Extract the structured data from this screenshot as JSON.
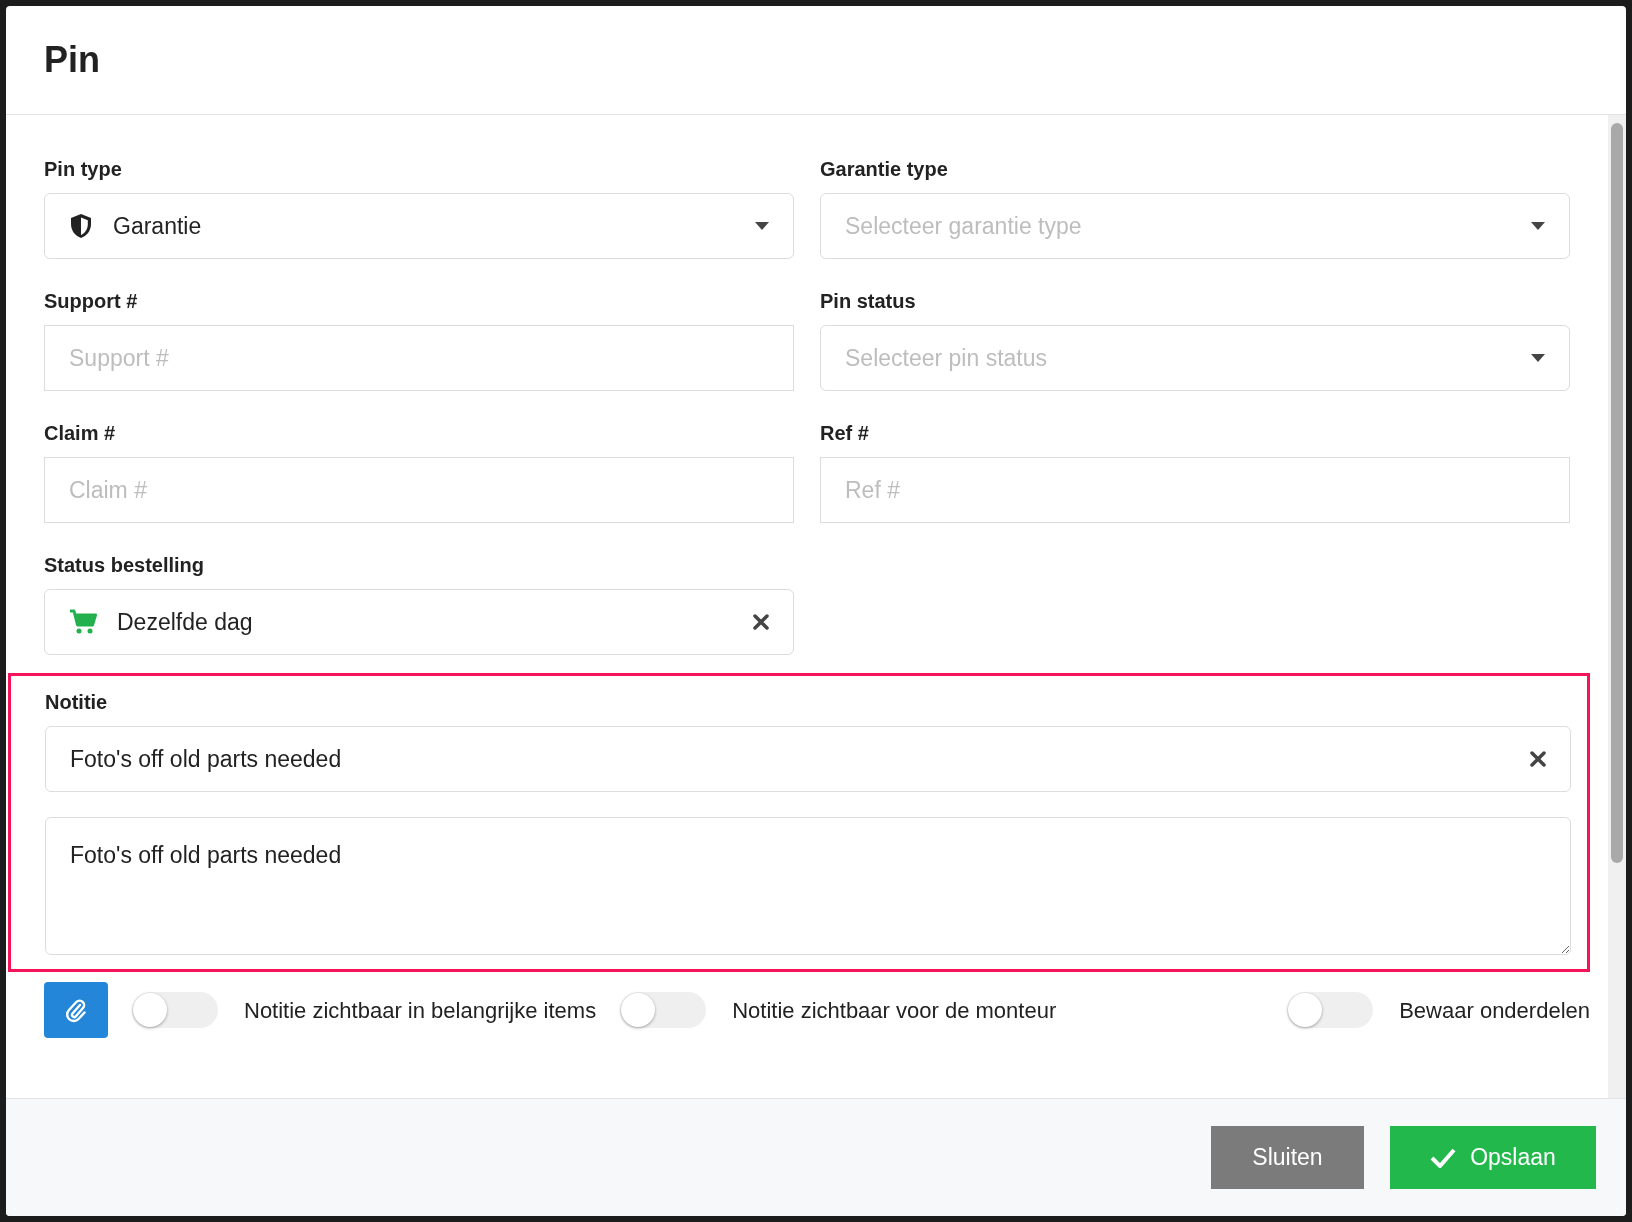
{
  "dialog": {
    "title": "Pin"
  },
  "fields": [
    {
      "kind": "type-select",
      "label": "Pin type",
      "value": "Garantie"
    },
    {
      "kind": "select",
      "label": "Garantie type",
      "placeholder": "Selecteer garantie type"
    },
    {
      "kind": "text",
      "label": "Support #",
      "placeholder": "Support #"
    },
    {
      "kind": "select",
      "label": "Pin status",
      "placeholder": "Selecteer pin status"
    },
    {
      "kind": "text",
      "label": "Claim #",
      "placeholder": "Claim #"
    },
    {
      "kind": "text",
      "label": "Ref #",
      "placeholder": "Ref #"
    },
    {
      "kind": "status-select",
      "label": "Status bestelling",
      "value": "Dezelfde dag"
    }
  ],
  "note": {
    "label": "Notitie",
    "highlighted": true,
    "value": "Foto's off old parts needed",
    "text": "Foto's off old parts needed"
  },
  "toggles": [
    {
      "label": "Notitie zichtbaar in belangrijke items",
      "on": false
    },
    {
      "label": "Notitie zichtbaar voor de monteur",
      "on": false
    },
    {
      "label": "Bewaar onderdelen",
      "on": false
    }
  ],
  "buttons": [
    {
      "kind": "secondary",
      "label": "Sluiten"
    },
    {
      "kind": "primary",
      "label": "Opslaan"
    }
  ]
}
